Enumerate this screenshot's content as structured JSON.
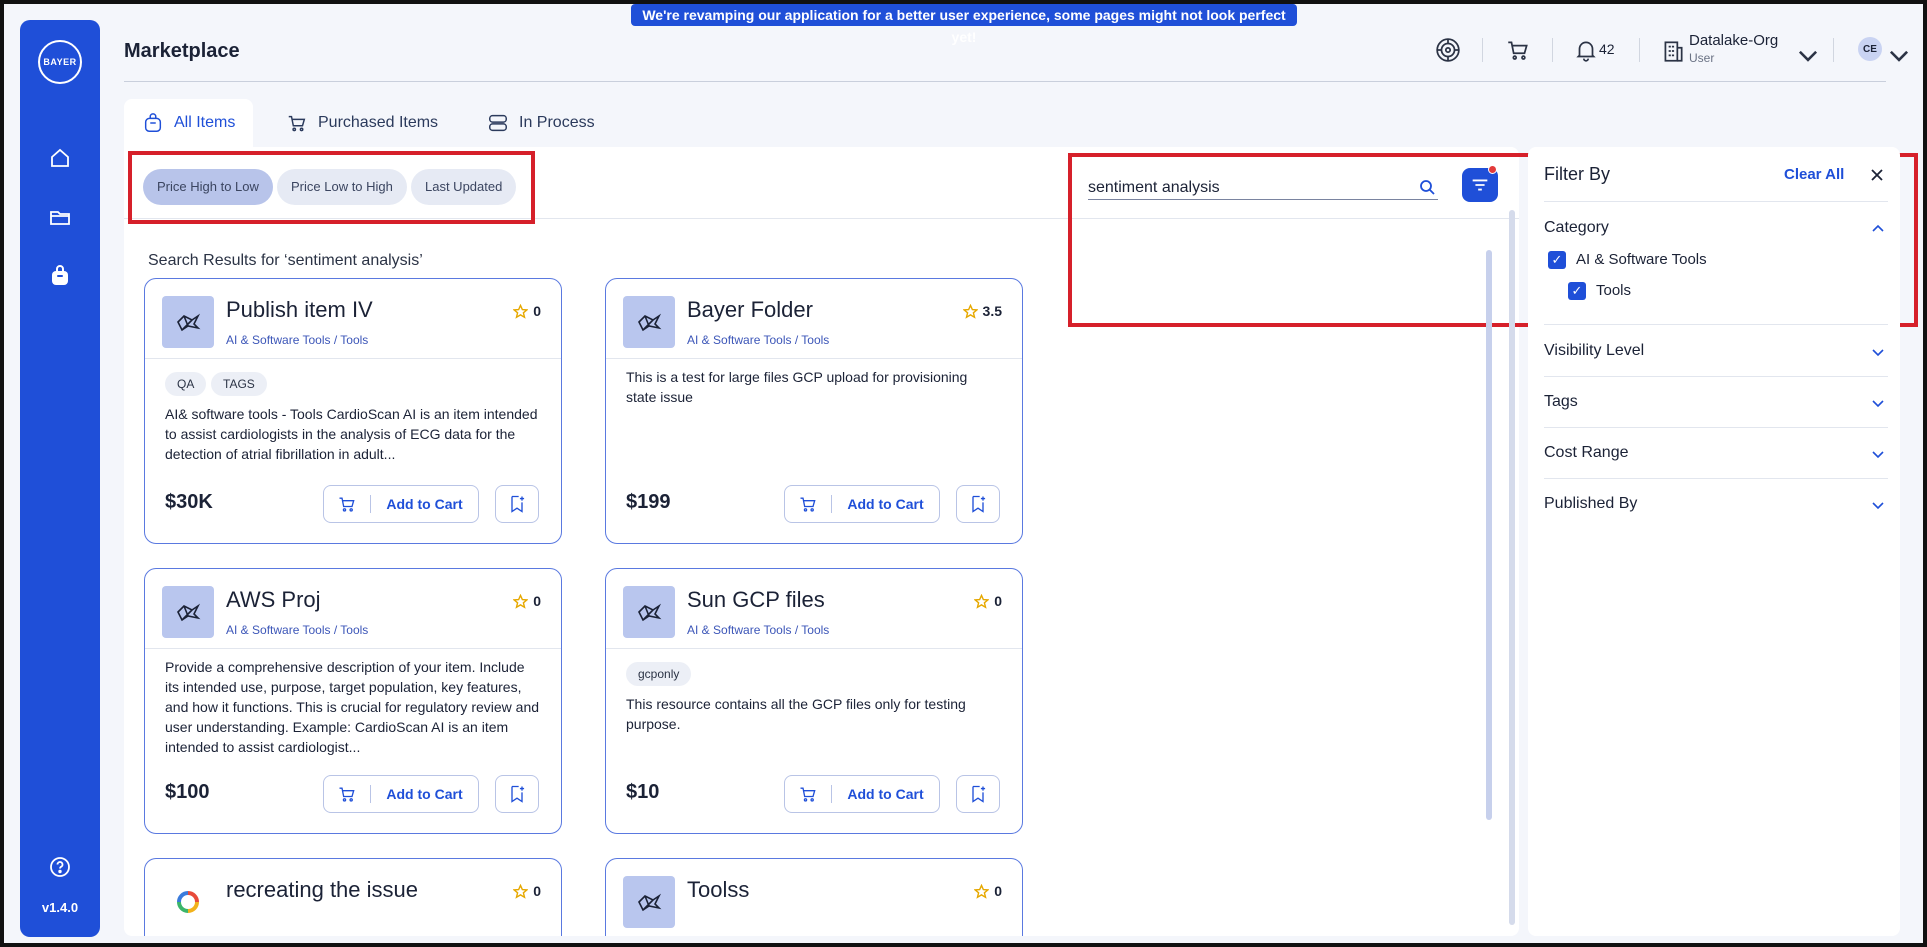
{
  "banner": "We're revamping our application for a better user experience, some pages might not look perfect yet!",
  "sidebar": {
    "logo": "BAYER",
    "version": "v1.4.0"
  },
  "header": {
    "title": "Marketplace",
    "notifications": "42",
    "org_name": "Datalake-Org",
    "org_role": "User",
    "avatar": "CE"
  },
  "tabs": [
    {
      "label": "All Items",
      "active": true
    },
    {
      "label": "Purchased Items"
    },
    {
      "label": "In Process"
    }
  ],
  "sort": [
    {
      "label": "Price High to Low",
      "active": true
    },
    {
      "label": "Price Low to High"
    },
    {
      "label": "Last Updated"
    }
  ],
  "search": {
    "value": "sentiment analysis"
  },
  "results_title": "Search Results for ‘sentiment analysis’",
  "cards": [
    {
      "title": "Publish item IV",
      "category": "AI & Software Tools / Tools",
      "rating": "0",
      "tags": [
        "QA",
        "TAGS"
      ],
      "description": "AI& software tools - Tools CardioScan AI is an item intended to assist cardiologists in the analysis of ECG data for the detection of atrial fibrillation in adult...",
      "price": "$30K"
    },
    {
      "title": "Bayer Folder",
      "category": "AI & Software Tools / Tools",
      "rating": "3.5",
      "tags": [],
      "description": "This is a test for large files GCP upload for provisioning state issue",
      "price": "$199"
    },
    {
      "title": "AWS Proj",
      "category": "AI & Software Tools / Tools",
      "rating": "0",
      "tags": [],
      "description": "Provide a comprehensive description of your item. Include its intended use, purpose, target population, key features, and how it functions. This is crucial for regulatory review and user understanding. Example: CardioScan AI is an item intended to assist cardiologist...",
      "price": "$100"
    },
    {
      "title": "Sun GCP files",
      "category": "AI & Software Tools / Tools",
      "rating": "0",
      "tags": [
        "gcponly"
      ],
      "description": "This resource contains all the GCP files only for testing purpose.",
      "price": "$10"
    },
    {
      "title": "recreating the issue",
      "rating": "0"
    },
    {
      "title": "Toolss",
      "rating": "0"
    }
  ],
  "add_to_cart": "Add to Cart",
  "filter_panel": {
    "title": "Filter By",
    "clear_all": "Clear All",
    "sections": [
      "Category",
      "Visibility Level",
      "Tags",
      "Cost Range",
      "Published By"
    ],
    "category_options": [
      "AI & Software Tools",
      "Tools"
    ]
  },
  "colors": {
    "primary": "#1f4fd8",
    "highlight": "#d6202a",
    "star": "#e6a800"
  }
}
